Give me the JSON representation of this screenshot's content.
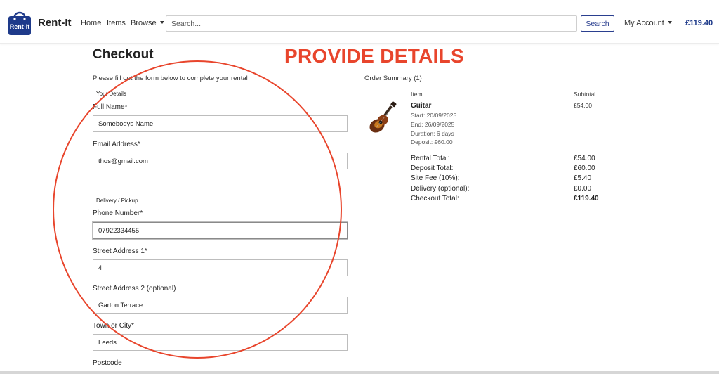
{
  "navbar": {
    "logo_text": "Rent-It",
    "brand": "Rent-It",
    "links": {
      "home": "Home",
      "items": "Items",
      "browse": "Browse"
    },
    "search_placeholder": "Search...",
    "search_button": "Search",
    "account": "My Account",
    "basket_total": "£119.40"
  },
  "annotation": {
    "title": "PROVIDE DETAILS",
    "color": "#e8452c"
  },
  "checkout": {
    "title": "Checkout",
    "intro": "Please fill out the form below to complete your rental",
    "your_details_label": "Your Details",
    "full_name_label": "Full Name*",
    "full_name_value": "Somebodys Name",
    "email_label": "Email Address*",
    "email_value": "thos@gmail.com",
    "delivery_label": "Delivery / Pickup",
    "phone_label": "Phone Number*",
    "phone_value": "07922334455",
    "street1_label": "Street Address 1*",
    "street1_value": "4",
    "street2_label": "Street Address 2 (optional)",
    "street2_value": "Garton Terrace",
    "town_label": "Town or City*",
    "town_value": "Leeds",
    "postcode_label": "Postcode"
  },
  "summary": {
    "title": "Order Summary (1)",
    "col_item": "Item",
    "col_subtotal": "Subtotal",
    "item": {
      "name": "Guitar",
      "start": "Start: 20/09/2025",
      "end": "End: 26/09/2025",
      "duration": "Duration: 6 days",
      "deposit": "Deposit: £60.00",
      "subtotal": "£54.00",
      "icon": "guitar-image"
    },
    "totals": {
      "rental_label": "Rental Total:",
      "rental_value": "£54.00",
      "deposit_label": "Deposit Total:",
      "deposit_value": "£60.00",
      "fee_label": "Site Fee (10%):",
      "fee_value": "£5.40",
      "delivery_label": "Delivery (optional):",
      "delivery_value": "£0.00",
      "checkout_label": "Checkout Total:",
      "checkout_value": "£119.40"
    }
  },
  "colors": {
    "brand_blue": "#1e3a8a",
    "annotation_red": "#e8452c"
  }
}
